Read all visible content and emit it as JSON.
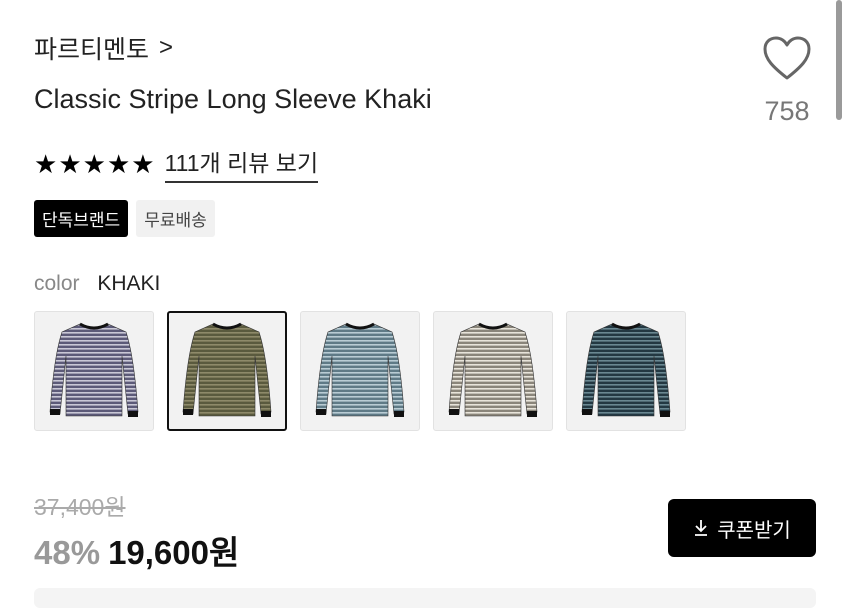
{
  "brand": {
    "name": "파르티멘토",
    "chevron": ">"
  },
  "product": {
    "title": "Classic Stripe Long Sleeve Khaki"
  },
  "wishlist": {
    "count": "758",
    "icon": "heart-icon"
  },
  "rating": {
    "stars": 5,
    "star_char": "★",
    "reviews_label": "111개 리뷰 보기"
  },
  "badges": [
    {
      "label": "단독브랜드"
    },
    {
      "label": "무료배송"
    }
  ],
  "color": {
    "label": "color",
    "value": "KHAKI"
  },
  "swatches": [
    {
      "name": "purple-stripe",
      "body": "#5c5a78",
      "stripe": "#c9c8d6",
      "selected": false
    },
    {
      "name": "khaki-stripe",
      "body": "#5a5a3e",
      "stripe": "#8e8a6a",
      "selected": true
    },
    {
      "name": "blue-stripe",
      "body": "#5f7a86",
      "stripe": "#b9ccd4",
      "selected": false
    },
    {
      "name": "beige-stripe",
      "body": "#8a857a",
      "stripe": "#e8e4da",
      "selected": false
    },
    {
      "name": "navy-stripe",
      "body": "#233842",
      "stripe": "#6a8892",
      "selected": false
    }
  ],
  "price": {
    "original": "37,400원",
    "discount": "48%",
    "final": "19,600원"
  },
  "coupon": {
    "label": "쿠폰받기",
    "icon": "download-icon"
  }
}
